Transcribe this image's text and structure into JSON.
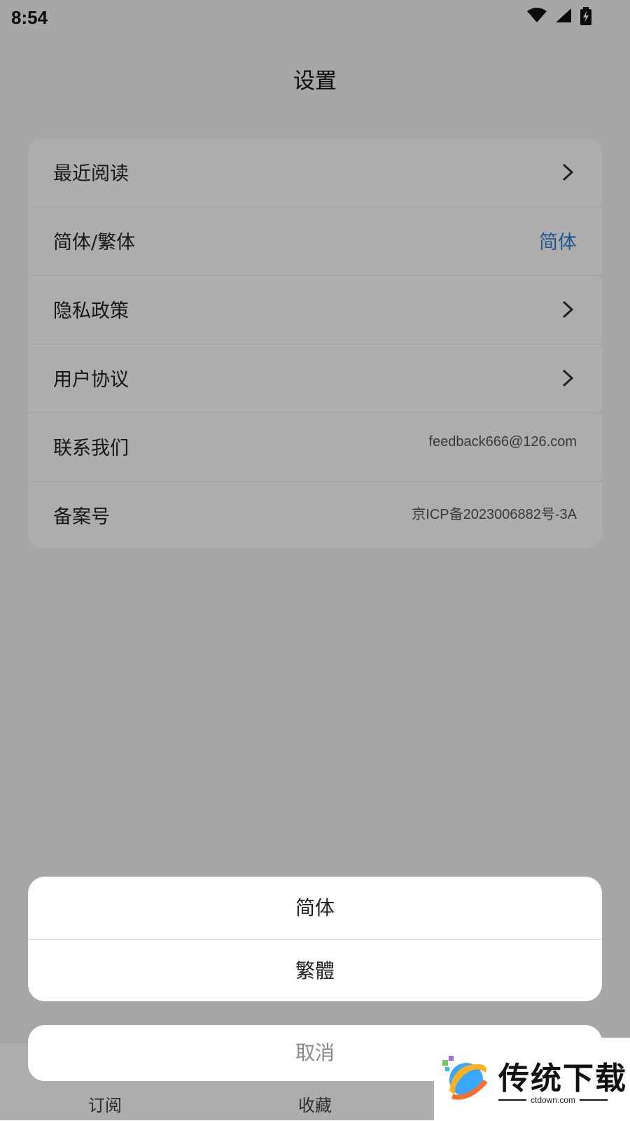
{
  "status_bar": {
    "time": "8:54",
    "icons": [
      "wifi-icon",
      "cell-signal-icon",
      "battery-charging-icon"
    ]
  },
  "page": {
    "title": "设置"
  },
  "settings": [
    {
      "label": "最近阅读",
      "type": "chevron"
    },
    {
      "label": "简体/繁体",
      "type": "value",
      "value": "简体",
      "value_color": "#2f7fd1"
    },
    {
      "label": "隐私政策",
      "type": "chevron"
    },
    {
      "label": "用户协议",
      "type": "chevron"
    },
    {
      "label": "联系我们",
      "type": "value",
      "value": "feedback666@126.com"
    },
    {
      "label": "备案号",
      "type": "value",
      "value": "京ICP备2023006882号-3A"
    }
  ],
  "tab_bar": {
    "items": [
      "订阅",
      "收藏"
    ]
  },
  "action_sheet": {
    "options": [
      "简体",
      "繁體"
    ],
    "cancel": "取消"
  },
  "watermark": {
    "text": "传统下载",
    "subtext": "ctdown.com"
  },
  "colors": {
    "accent": "#2f7fd1",
    "overlay": "rgba(0,0,0,0.32)"
  }
}
